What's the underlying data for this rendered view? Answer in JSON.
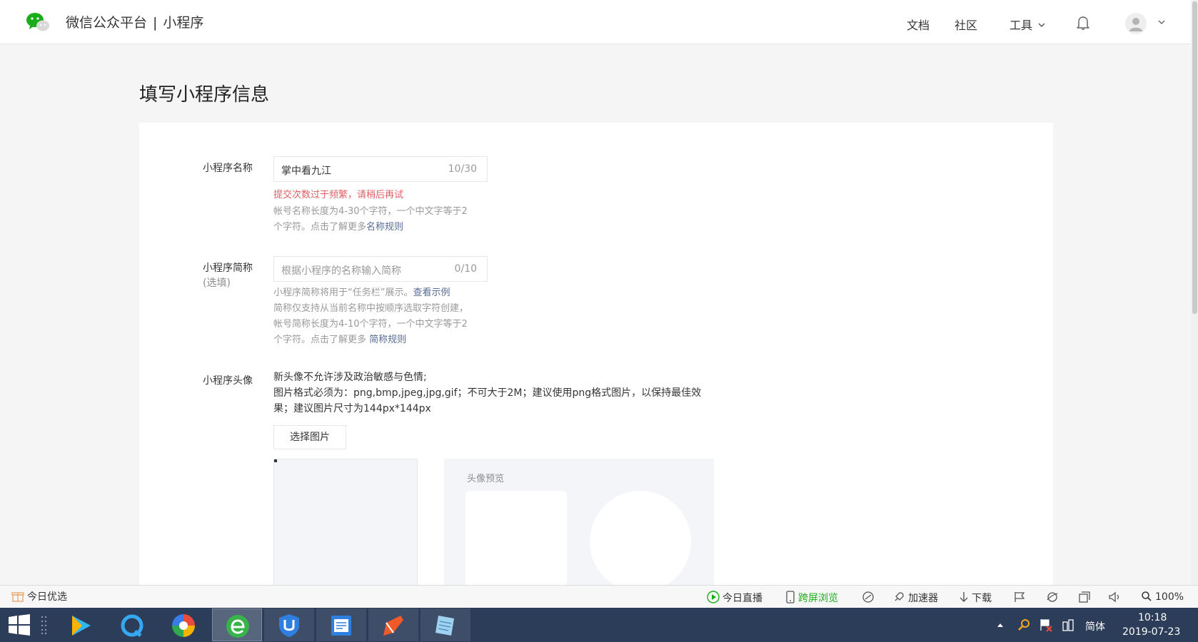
{
  "header": {
    "brand": "微信公众平台",
    "separator": "|",
    "product": "小程序",
    "nav": [
      "文档",
      "社区",
      "工具"
    ]
  },
  "page": {
    "title": "填写小程序信息"
  },
  "form": {
    "name": {
      "label": "小程序名称",
      "value": "掌中看九江",
      "counter": "10/30",
      "error": "提交次数过于频繁，请稍后再试",
      "tip_line1": "帐号名称长度为4-30个字符，一个中文字等于2",
      "tip_line2": "个字符。点击了解更多",
      "tip_link": "名称规则"
    },
    "short_name": {
      "label": "小程序简称",
      "label_sub": "(选填)",
      "placeholder": "根据小程序的名称输入简称",
      "counter": "0/10",
      "tip_line1": "小程序简称将用于“任务栏”展示。",
      "tip_line1_link": "查看示例",
      "tip_line2": "简称仅支持从当前名称中按顺序选取字符创建，",
      "tip_line3": "帐号简称长度为4-10个字符，一个中文字等于2",
      "tip_line4": "个字符。点击了解更多 ",
      "tip_line4_link": "简称规则"
    },
    "avatar": {
      "label": "小程序头像",
      "desc_line1": "新头像不允许涉及政治敏感与色情;",
      "desc_line2": "图片格式必须为：png,bmp,jpeg,jpg,gif；不可大于2M；建议使用png格式图片，以保持最佳效",
      "desc_line3": "果；建议图片尺寸为144px*144px",
      "button": "选择图片",
      "preview_label": "头像预览"
    }
  },
  "browser_status": {
    "left": "今日优选",
    "live": "今日直播",
    "cross": "跨屏浏览",
    "accelerator": "加速器",
    "download": "下载",
    "zoom": "100%"
  },
  "taskbar": {
    "ime": "简体",
    "time": "10:18",
    "date": "2019-07-23"
  },
  "colors": {
    "error": "#e15f63",
    "link": "#576b95",
    "wechat_green": "#1aad19",
    "taskbar": "#2c3d5a"
  }
}
